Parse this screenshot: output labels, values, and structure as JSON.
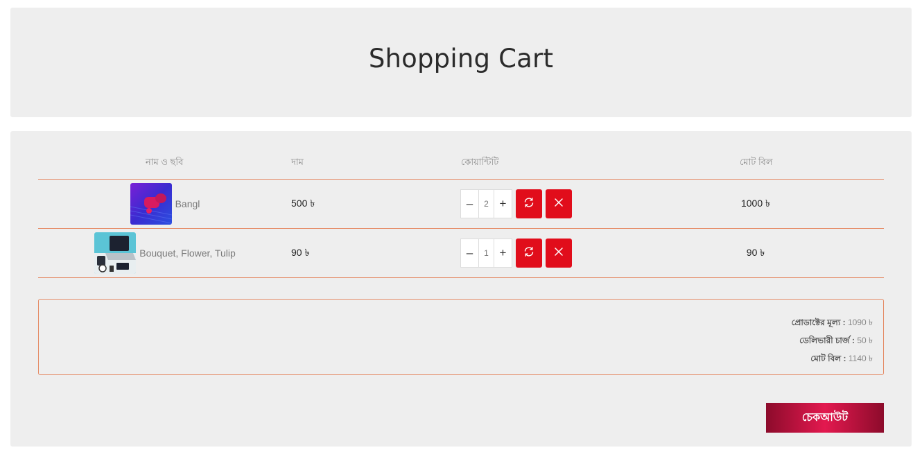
{
  "header": {
    "title": "Shopping Cart"
  },
  "table": {
    "columns": [
      "নাম ও ছবি",
      "দাম",
      "কোয়ান্টিটি",
      "মোট বিল"
    ],
    "rows": [
      {
        "name": "Bangl",
        "price": "500 ৳",
        "qty": "2",
        "total": "1000 ৳",
        "thumb_icon": "earbuds-image"
      },
      {
        "name": "Bouquet, Flower, Tulip",
        "price": "90 ৳",
        "qty": "1",
        "total": "90 ৳",
        "thumb_icon": "laptop-accessories-image"
      }
    ],
    "decrement_symbol": "–",
    "increment_symbol": "+"
  },
  "summary": {
    "product_price_label": "প্রোডাক্টের মূল্য :",
    "product_price_value": "1090 ৳",
    "delivery_label": "ডেলিভারী চার্জ :",
    "delivery_value": "50 ৳",
    "total_label": "মোট বিল :",
    "total_value": "1140 ৳"
  },
  "checkout": {
    "label": "চেকআউট"
  },
  "colors": {
    "accent_red": "#e10d1b",
    "border_orange": "#e58b66",
    "panel_bg": "#eeeeee"
  }
}
